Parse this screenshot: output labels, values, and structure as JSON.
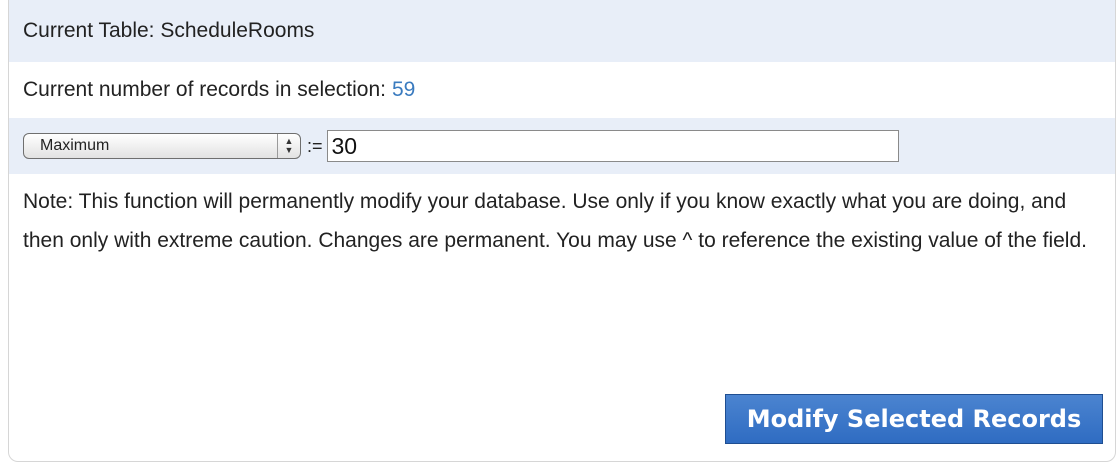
{
  "current_table": {
    "label": "Current Table: ScheduleRooms"
  },
  "record_count": {
    "label": "Current number of records in selection:",
    "value": "59"
  },
  "field_edit": {
    "selected_option": "Maximum",
    "assign_operator": ":=",
    "value": "30"
  },
  "note": {
    "text": "Note: This function will permanently modify your database. Use only if you know exactly what you are doing, and then only with extreme caution. Changes are permanent. You may use ^ to reference the existing value of the field."
  },
  "actions": {
    "modify_label": "Modify Selected Records"
  },
  "icons": {
    "select_arrows": "up-down-arrows-icon"
  },
  "colors": {
    "row_highlight": "#e8eef8",
    "count_text": "#3a7bbf",
    "button_bg": "#3a76c8"
  }
}
